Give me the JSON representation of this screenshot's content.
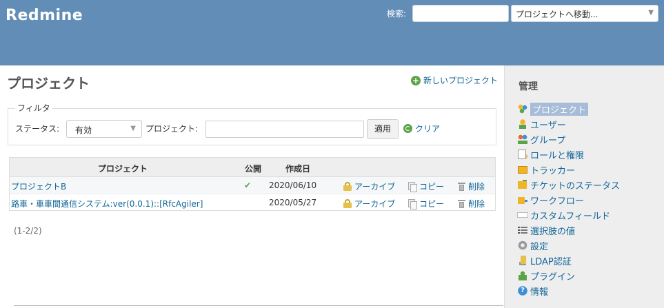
{
  "app": {
    "title": "Redmine"
  },
  "header": {
    "search_label": "検索:",
    "search_value": "",
    "jump_label": "プロジェクトへ移動..."
  },
  "page": {
    "title": "プロジェクト",
    "new_project_label": "新しいプロジェクト"
  },
  "filter": {
    "legend": "フィルタ",
    "status_label": "ステータス:",
    "status_value": "有効",
    "project_label": "プロジェクト:",
    "project_value": "",
    "apply_label": "適用",
    "clear_label": "クリア"
  },
  "table": {
    "headers": {
      "project": "プロジェクト",
      "public": "公開",
      "created": "作成日"
    },
    "rows": [
      {
        "name": "プロジェクトB",
        "public": true,
        "created": "2020/06/10",
        "archive": "アーカイブ",
        "copy": "コピー",
        "delete": "削除"
      },
      {
        "name": "路車・車車間通信システム:ver(0.0.1)::[RfcAgiler]",
        "public": false,
        "created": "2020/05/27",
        "archive": "アーカイブ",
        "copy": "コピー",
        "delete": "削除"
      }
    ]
  },
  "pagination": {
    "text": "(1-2/2)"
  },
  "sidebar": {
    "title": "管理",
    "items": [
      {
        "label": "プロジェクト",
        "icon": "projects-icon",
        "selected": true
      },
      {
        "label": "ユーザー",
        "icon": "user-icon"
      },
      {
        "label": "グループ",
        "icon": "group-icon"
      },
      {
        "label": "ロールと権限",
        "icon": "roles-icon"
      },
      {
        "label": "トラッカー",
        "icon": "tracker-icon"
      },
      {
        "label": "チケットのステータス",
        "icon": "issue-status-icon"
      },
      {
        "label": "ワークフロー",
        "icon": "workflow-icon"
      },
      {
        "label": "カスタムフィールド",
        "icon": "custom-field-icon"
      },
      {
        "label": "選択肢の値",
        "icon": "enumeration-icon"
      },
      {
        "label": "設定",
        "icon": "settings-icon"
      },
      {
        "label": "LDAP認証",
        "icon": "ldap-icon"
      },
      {
        "label": "プラグイン",
        "icon": "plugin-icon"
      },
      {
        "label": "情報",
        "icon": "info-icon"
      }
    ]
  }
}
